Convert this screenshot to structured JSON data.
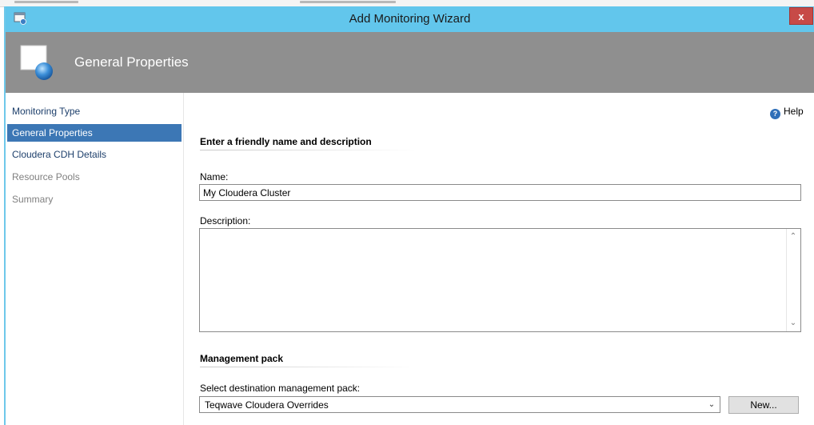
{
  "window": {
    "title": "Add Monitoring Wizard",
    "close_label": "x"
  },
  "header": {
    "title": "General Properties",
    "icon": "wizard-page-icon"
  },
  "nav": {
    "items": [
      {
        "label": "Monitoring Type",
        "state": "done"
      },
      {
        "label": "General Properties",
        "state": "current"
      },
      {
        "label": "Cloudera CDH Details",
        "state": "done"
      },
      {
        "label": "Resource Pools",
        "state": "future"
      },
      {
        "label": "Summary",
        "state": "future"
      }
    ]
  },
  "help": {
    "label": "Help",
    "icon": "help-icon"
  },
  "section_name": {
    "heading": "Enter a friendly name and description",
    "name_label": "Name:",
    "name_value": "My Cloudera Cluster",
    "description_label": "Description:",
    "description_value": ""
  },
  "section_mp": {
    "heading": "Management pack",
    "select_label": "Select destination management pack:",
    "select_value": "Teqwave Cloudera Overrides",
    "new_button": "New..."
  },
  "colors": {
    "titlebar": "#62c6ec",
    "header_band": "#8f8f8f",
    "nav_selected": "#3c77b5",
    "close_button": "#c74a47"
  }
}
